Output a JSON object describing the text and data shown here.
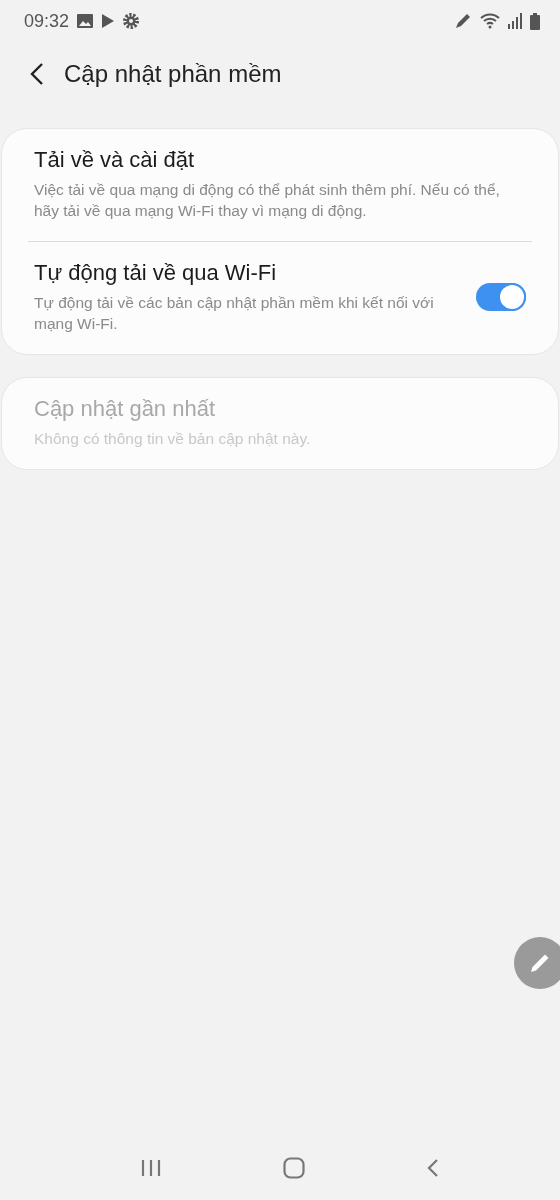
{
  "status_bar": {
    "time": "09:32"
  },
  "header": {
    "title": "Cập nhật phần mềm"
  },
  "cards": [
    {
      "items": [
        {
          "kind": "text",
          "title": "Tải về và cài đặt",
          "subtitle": "Việc tải về qua mạng di động có thể phát sinh thêm phí. Nếu có thể, hãy tải về qua mạng Wi-Fi thay vì mạng di động.",
          "disabled": false
        },
        {
          "kind": "toggle",
          "title": "Tự động tải về qua Wi-Fi",
          "subtitle": "Tự động tải về các bản cập nhật phần mềm khi kết nối với mạng Wi-Fi.",
          "disabled": false,
          "on": true
        }
      ]
    },
    {
      "items": [
        {
          "kind": "text",
          "title": "Cập nhật gần nhất",
          "subtitle": "Không có thông tin về bản cập nhật này.",
          "disabled": true
        }
      ]
    }
  ]
}
